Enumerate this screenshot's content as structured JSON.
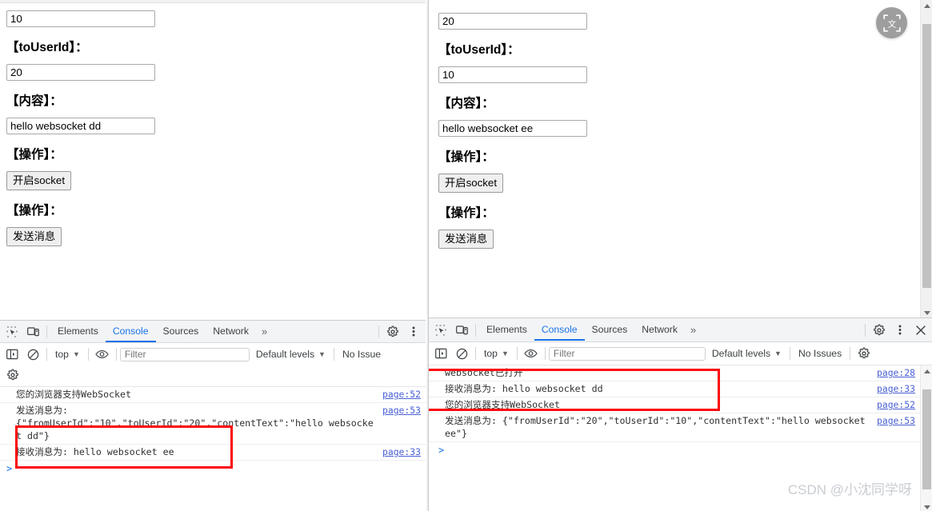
{
  "left_window": {
    "form": {
      "from_user_id_value": "10",
      "to_user_id_label": "【toUserId】：",
      "to_user_id_value": "20",
      "content_label": "【内容】：",
      "content_value": "hello websocket dd",
      "operation_label_1": "【操作】：",
      "open_socket_button": "开启socket",
      "operation_label_2": "【操作】：",
      "send_message_button": "发送消息"
    },
    "devtools": {
      "tabs": [
        {
          "label": "Elements",
          "active": false
        },
        {
          "label": "Console",
          "active": true
        },
        {
          "label": "Sources",
          "active": false
        },
        {
          "label": "Network",
          "active": false
        }
      ],
      "more_tabs": "»",
      "context": "top",
      "filter_placeholder": "Filter",
      "levels": "Default levels",
      "issues": "No Issue",
      "console_rows": [
        {
          "message": "您的浏览器支持WebSocket",
          "source": "page:52"
        },
        {
          "message": "发送消息为:\n{\"fromUserId\":\"10\",\"toUserId\":\"20\",\"contentText\":\"hello websocket dd\"}",
          "source": "page:53"
        },
        {
          "message": "接收消息为: hello websocket ee",
          "source": "page:33"
        }
      ],
      "prompt": ">"
    }
  },
  "right_window": {
    "form": {
      "from_user_id_value": "20",
      "to_user_id_label": "【toUserId】：",
      "to_user_id_value": "10",
      "content_label": "【内容】：",
      "content_value": "hello websocket ee",
      "operation_label_1": "【操作】：",
      "open_socket_button": "开启socket",
      "operation_label_2": "【操作】：",
      "send_message_button": "发送消息"
    },
    "translate_fab": "translate-icon",
    "devtools": {
      "tabs": [
        {
          "label": "Elements",
          "active": false
        },
        {
          "label": "Console",
          "active": true
        },
        {
          "label": "Sources",
          "active": false
        },
        {
          "label": "Network",
          "active": false
        }
      ],
      "more_tabs": "»",
      "context": "top",
      "filter_placeholder": "Filter",
      "levels": "Default levels",
      "issues": "No Issues",
      "console_rows": [
        {
          "message": "websocket已打开",
          "source": "page:28"
        },
        {
          "message": "接收消息为: hello websocket dd",
          "source": "page:33"
        },
        {
          "message": "您的浏览器支持WebSocket",
          "source": "page:52"
        },
        {
          "message": "发送消息为: {\"fromUserId\":\"20\",\"toUserId\":\"10\",\"contentText\":\"hello websocket ee\"}",
          "source": "page:53"
        }
      ],
      "prompt": ">"
    }
  },
  "watermark": "CSDN @小沈同学呀",
  "colors": {
    "accent": "#1a73e8",
    "highlight_box": "#fb0a0a",
    "link": "#4a5fd4",
    "toolbar_bg": "#f3f4f6"
  }
}
